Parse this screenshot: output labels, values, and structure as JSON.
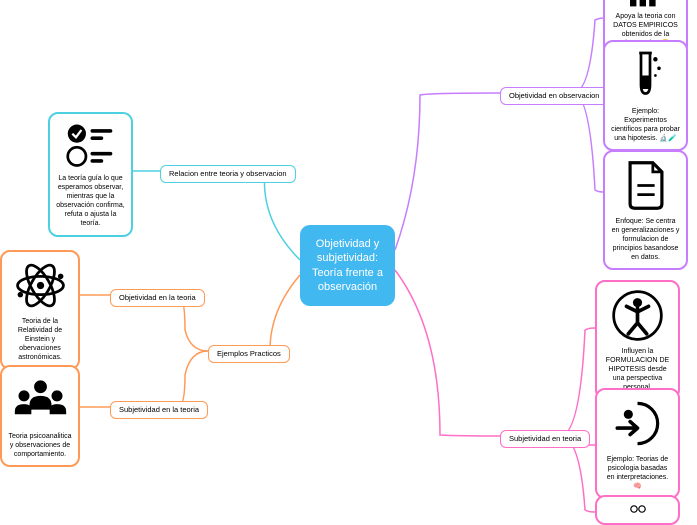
{
  "center": "Objetividad y subjetividad: Teoría frente a observación",
  "left": {
    "relacion": {
      "label": "Relacion entre teoria y observacion",
      "card": "La teoría guía lo que esperamos observar, mientras que la observación confirma, refuta o ajusta la teoría."
    },
    "ejemplos": {
      "label": "Ejemplos Practicos",
      "obj": {
        "label": "Objetividad en la teoria",
        "card": "Teoria de la Relatividad de Einstein y obervaciones astronómicas."
      },
      "subj": {
        "label": "Subjetividad en la teoria",
        "card": "Teoria psicoanalitica y observaciones de comportamiento."
      }
    }
  },
  "right": {
    "objObs": {
      "label": "Objetividad en observacion",
      "card1": "Apoya la teoria con DATOS EMPIRICOS obtenidos de la observacion 😊",
      "card2": "Ejemplo: Experimentos cientificos para probar una hipotesis. 🔬🧪",
      "card3": "Enfoque: Se centra en generalizaciones y formulacion de principios basandose en datos."
    },
    "subjTeo": {
      "label": "Subjetividad en teoria",
      "card1": "Influyen la FORMULACION DE HIPOTESIS desde una perspectiva personal.",
      "card2": "Ejemplo: Teorias de psicologia basadas en interpretaciones. 🧠"
    }
  }
}
